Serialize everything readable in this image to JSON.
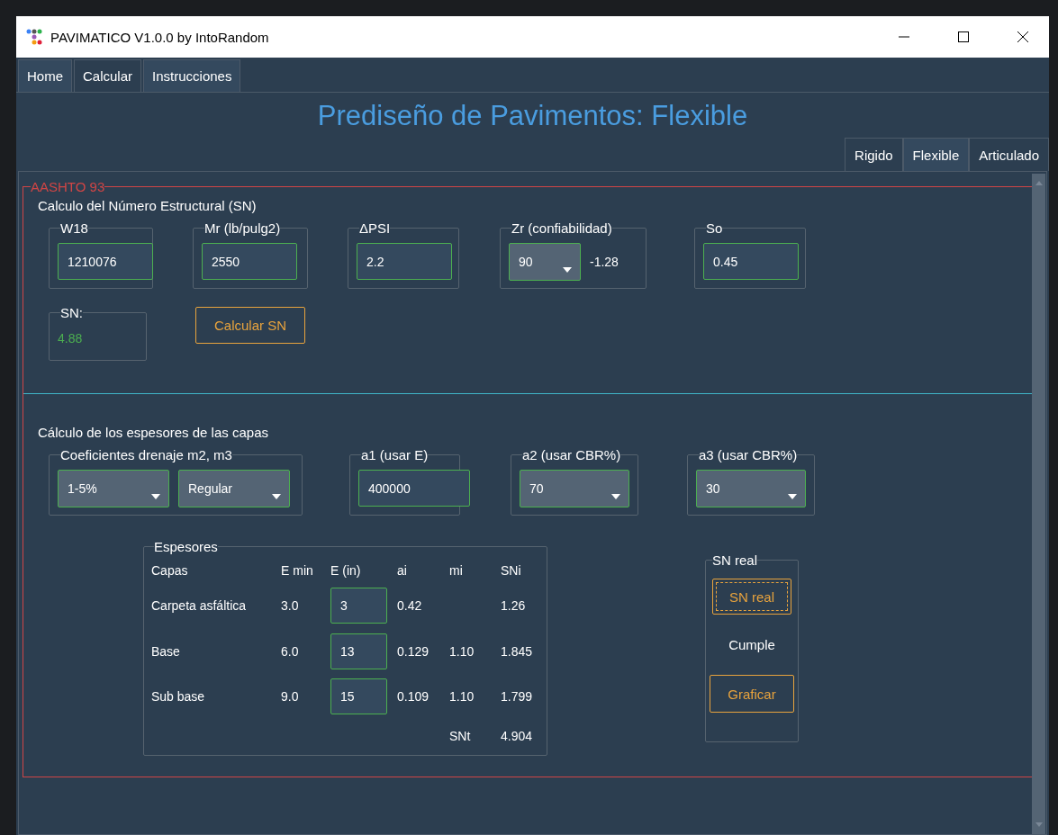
{
  "window": {
    "title": "PAVIMATICO V1.0.0 by IntoRandom"
  },
  "tabs": [
    {
      "label": "Home",
      "selected": false
    },
    {
      "label": "Calcular",
      "selected": true
    },
    {
      "label": "Instrucciones",
      "selected": false
    }
  ],
  "heading": "Prediseño de Pavimentos: Flexible",
  "subtabs": [
    {
      "label": "Rigido",
      "selected": false
    },
    {
      "label": "Flexible",
      "selected": true
    },
    {
      "label": "Articulado",
      "selected": false
    }
  ],
  "panel": {
    "legend": "AASHTO 93",
    "sn_section": {
      "title": "Calculo del Número Estructural (SN)",
      "groups": [
        {
          "label": "W18",
          "fields": [
            {
              "kind": "input",
              "value": "1210076"
            }
          ]
        },
        {
          "label": "Mr (lb/pulg2)",
          "fields": [
            {
              "kind": "input",
              "value": "2550"
            }
          ]
        },
        {
          "label": "ΔPSI",
          "fields": [
            {
              "kind": "input",
              "value": "2.2"
            }
          ]
        },
        {
          "label": "Zr (confiabilidad)",
          "fields": [
            {
              "kind": "select",
              "value": "90"
            },
            {
              "kind": "reading",
              "value": "-1.28"
            }
          ]
        },
        {
          "label": "So",
          "fields": [
            {
              "kind": "input",
              "value": "0.45"
            }
          ]
        }
      ],
      "result": {
        "label": "SN:",
        "value": "4.88"
      },
      "button": "Calcular SN"
    },
    "layers_section": {
      "title": "Cálculo de los espesores de las capas",
      "groups": [
        {
          "label": "Coeficientes drenaje m2, m3",
          "fields": [
            {
              "kind": "select",
              "value": "1-5%"
            },
            {
              "kind": "select",
              "value": "Regular"
            }
          ]
        },
        {
          "label": "a1 (usar E)",
          "fields": [
            {
              "kind": "input",
              "value": "400000"
            }
          ]
        },
        {
          "label": "a2 (usar CBR%)",
          "fields": [
            {
              "kind": "select",
              "value": "70"
            }
          ]
        },
        {
          "label": "a3 (usar CBR%)",
          "fields": [
            {
              "kind": "select",
              "value": "30"
            }
          ]
        }
      ],
      "table": {
        "legend": "Espesores",
        "columns": [
          "Capas",
          "E min",
          "E (in)",
          "ai",
          "mi",
          "SNi"
        ],
        "rows": [
          {
            "layer": "Carpeta asfáltica",
            "e_min": "3.0",
            "e_in": "3",
            "ai": "0.42",
            "sni": "1.26"
          },
          {
            "layer": "Base",
            "e_min": "6.0",
            "e_in": "13",
            "ai": "0.129",
            "mi": "1.10",
            "sni": "1.845"
          },
          {
            "layer": "Sub base",
            "e_min": "9.0",
            "e_in": "15",
            "ai": "0.109",
            "mi": "1.10",
            "sni": "1.799"
          }
        ],
        "total": {
          "label": "SNt",
          "value": "4.904"
        }
      },
      "sn_real": {
        "legend": "SN real",
        "button": "SN real",
        "status": "Cumple",
        "graph_button": "Graficar"
      }
    }
  }
}
